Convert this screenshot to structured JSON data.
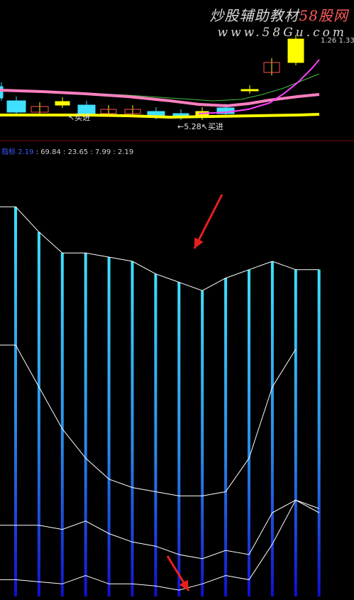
{
  "watermark": {
    "line1_prefix": "炒股辅助教材",
    "line1_red": "58股网",
    "line2": "www.58Gu.com"
  },
  "price_panel": {
    "annotations": [
      "买进",
      "5.28",
      "买进"
    ],
    "top_price_label": "1.26 1.33"
  },
  "indicator_header": {
    "name": "指标",
    "first_value": "2.19",
    "values": [
      "69.84",
      "23.65",
      "7.99",
      "2.19"
    ]
  },
  "colors": {
    "background": "#000000",
    "bar_top": "#40e0ff",
    "bar_bottom": "#1010d0",
    "line": "#ffffff",
    "arrow": "#e8201c",
    "candle_up": "#ffff00",
    "candle_down": "#40e0ff",
    "ma_magenta": "#ff40ff",
    "ma_pink": "#ff80c0",
    "ma_green": "#40c040",
    "ma_yellow": "#ffff00"
  },
  "chart_data": {
    "type": "bar",
    "categories": [
      "1",
      "2",
      "3",
      "4",
      "5",
      "6",
      "7",
      "8",
      "9",
      "10",
      "11",
      "12",
      "13",
      "14"
    ],
    "ylim": [
      0,
      100
    ],
    "series": [
      {
        "values": [
          93,
          87,
          82,
          82,
          81,
          80,
          77,
          75,
          73,
          76,
          78,
          80,
          78,
          78
        ]
      },
      {
        "values": [
          60,
          50,
          40,
          33,
          28,
          26,
          25,
          24,
          24,
          25,
          33,
          50,
          59
        ]
      },
      {
        "values": [
          17,
          17,
          16,
          18,
          15,
          13,
          12,
          10,
          9,
          11,
          10,
          20,
          23,
          21
        ]
      },
      {
        "values": [
          4.0,
          3.5,
          3.0,
          5.0,
          3.0,
          3.0,
          2.5,
          1.5,
          3.0,
          5.0,
          4.0,
          12.5,
          23,
          20
        ]
      }
    ]
  }
}
